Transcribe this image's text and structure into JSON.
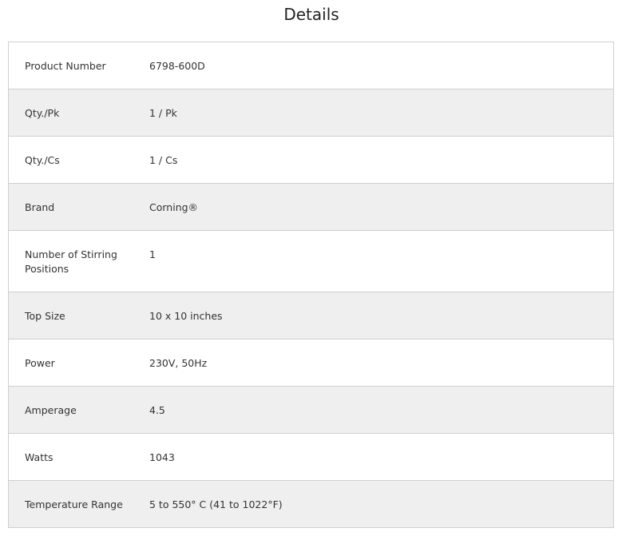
{
  "title": "Details",
  "rows": [
    {
      "label": "Product Number",
      "value": "6798-600D"
    },
    {
      "label": "Qty./Pk",
      "value": "1 / Pk"
    },
    {
      "label": "Qty./Cs",
      "value": "1 / Cs"
    },
    {
      "label": "Brand",
      "value": "Corning®"
    },
    {
      "label": "Number of Stirring Positions",
      "value": "1"
    },
    {
      "label": "Top Size",
      "value": "10 x 10 inches"
    },
    {
      "label": "Power",
      "value": "230V, 50Hz"
    },
    {
      "label": "Amperage",
      "value": "4.5"
    },
    {
      "label": "Watts",
      "value": "1043"
    },
    {
      "label": "Temperature Range",
      "value": "5 to 550° C (41 to 1022°F)"
    }
  ]
}
